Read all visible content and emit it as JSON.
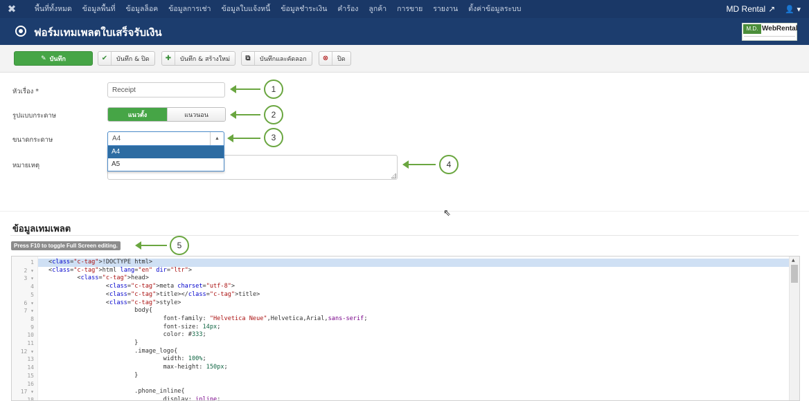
{
  "topnav": {
    "logo_icon": "joomla-icon",
    "menu": [
      "พื้นที่ทั้งหมด",
      "ข้อมูลพื้นที่",
      "ข้อมูลล็อค",
      "ข้อมูลการเช่า",
      "ข้อมูลใบแจ้งหนี้",
      "ข้อมูลชำระเงิน",
      "คำร้อง",
      "ลูกค้า",
      "การขาย",
      "รายงาน",
      "ตั้งค่าข้อมูลระบบ"
    ],
    "site_name": "MD Rental",
    "site_link_icon": "external-link-icon",
    "user_icon": "user-icon"
  },
  "header": {
    "icon": "radio-target-icon",
    "title": "ฟอร์มเทมเพลตใบเสร็จรับเงิน",
    "brand_md": "M.D.",
    "brand_name": "WebRental"
  },
  "toolbar": {
    "save_label": "บันทึก",
    "save_icon": "edit-icon",
    "save_close_label": "บันทึก & ปิด",
    "save_close_icon": "check-icon",
    "save_new_label": "บันทึก & สร้างใหม่",
    "save_new_icon": "plus-icon",
    "save_copy_label": "บันทึกและคัดลอก",
    "save_copy_icon": "copy-icon",
    "close_label": "ปิด",
    "close_icon": "close-circle-icon"
  },
  "form": {
    "title_label": "หัวเรื่อง *",
    "title_value": "Receipt",
    "orientation_label": "รูปแบบกระดาษ",
    "orientation_options": [
      "แนวตั้ง",
      "แนวนอน"
    ],
    "orientation_selected": "แนวตั้ง",
    "size_label": "ขนาดกระดาษ",
    "size_value": "A4",
    "size_options": [
      "A4",
      "A5"
    ],
    "note_label": "หมายเหตุ",
    "note_value": ""
  },
  "callouts": [
    "1",
    "2",
    "3",
    "4",
    "5"
  ],
  "colors": {
    "nav_bg": "#1a3867",
    "header_bg": "#1c3d6e",
    "save_green": "#46a546",
    "callout_green": "#6aa640",
    "dropdown_selected": "#2d6ca2"
  },
  "template_section": {
    "title": "ข้อมูลเทมเพลต",
    "fullscreen_hint": "Press F10 to toggle Full Screen editing."
  },
  "editor": {
    "line_numbers": [
      "1",
      "2 ▾",
      "3 ▾",
      "4",
      "5",
      "6 ▾",
      "7 ▾",
      "8",
      "9",
      "10",
      "11",
      "12 ▾",
      "13",
      "14",
      "15",
      "16",
      "17 ▾",
      "18"
    ],
    "lines": [
      "<!DOCTYPE html>",
      "<html lang=\"en\" dir=\"ltr\">",
      "        <head>",
      "                <meta charset=\"utf-8\">",
      "                <title></title>",
      "                <style>",
      "                        body{",
      "                                font-family: \"Helvetica Neue\",Helvetica,Arial,sans-serif;",
      "                                font-size: 14px;",
      "                                color: #333;",
      "                        }",
      "                        .image_logo{",
      "                                width: 100%;",
      "                                max-height: 150px;",
      "                        }",
      "",
      "                        .phone_inline{",
      "                                display: inline;"
    ]
  }
}
